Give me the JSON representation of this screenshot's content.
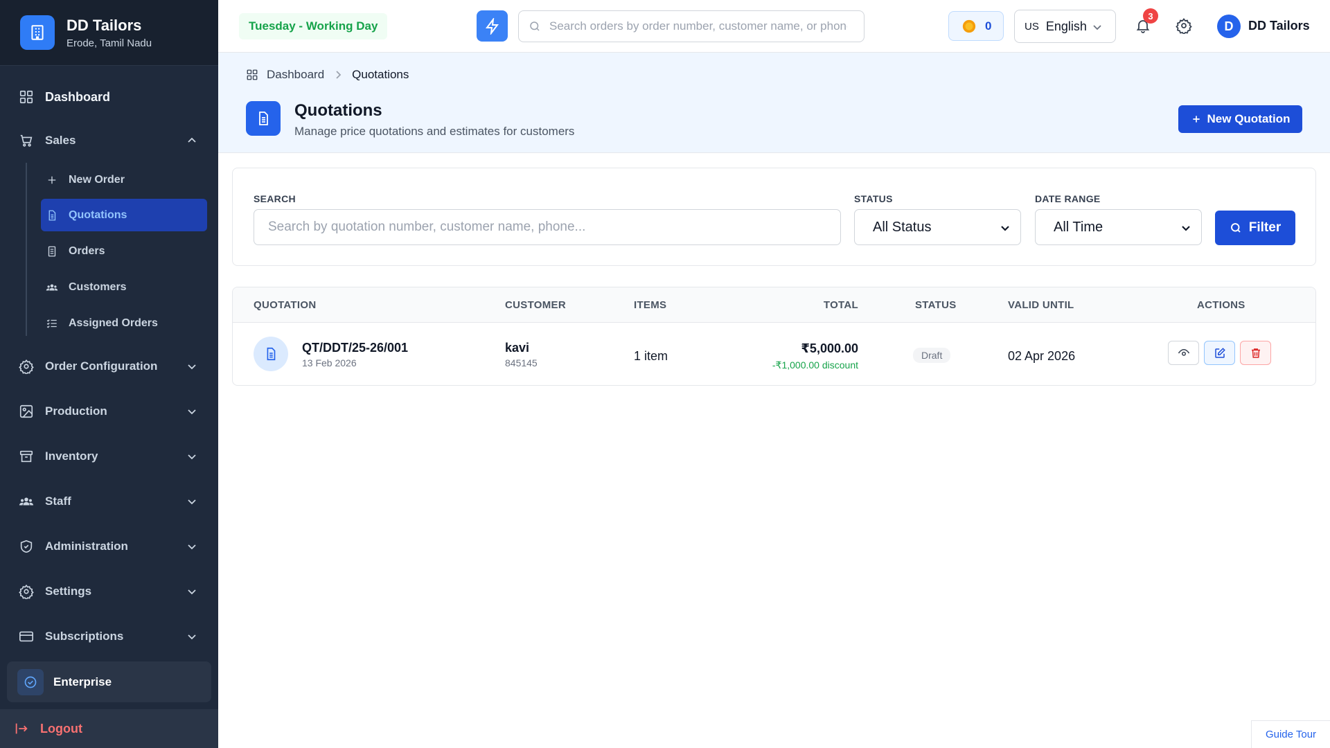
{
  "brand": {
    "name": "DD Tailors",
    "location": "Erode, Tamil Nadu"
  },
  "sidebar": {
    "dashboard": "Dashboard",
    "sales": "Sales",
    "sales_items": [
      "New Order",
      "Quotations",
      "Orders",
      "Customers",
      "Assigned Orders"
    ],
    "active_item": "Quotations",
    "sections": [
      "Order Configuration",
      "Production",
      "Inventory",
      "Staff",
      "Administration",
      "Settings",
      "Subscriptions"
    ],
    "plan": "Enterprise",
    "logout": "Logout"
  },
  "header": {
    "day_status": "Tuesday - Working Day",
    "search_placeholder": "Search orders by order number, customer name, or phone...",
    "coins": "0",
    "lang_flag": "US",
    "language": "English",
    "notifications": "3",
    "avatar_initial": "D",
    "user_name": "DD Tailors"
  },
  "breadcrumb": {
    "home": "Dashboard",
    "current": "Quotations"
  },
  "page": {
    "title": "Quotations",
    "subtitle": "Manage price quotations and estimates for customers",
    "new_button": "New Quotation"
  },
  "filters": {
    "search_label": "SEARCH",
    "search_placeholder": "Search by quotation number, customer name, phone...",
    "status_label": "STATUS",
    "status_value": "All Status",
    "date_label": "DATE RANGE",
    "date_value": "All Time",
    "filter_button": "Filter"
  },
  "table": {
    "columns": [
      "QUOTATION",
      "CUSTOMER",
      "ITEMS",
      "TOTAL",
      "STATUS",
      "VALID UNTIL",
      "ACTIONS"
    ],
    "rows": [
      {
        "number": "QT/DDT/25-26/001",
        "date": "13 Feb 2026",
        "customer": "kavi",
        "phone": "845145",
        "items": "1 item",
        "total": "₹5,000.00",
        "discount": "-₹1,000.00 discount",
        "status": "Draft",
        "valid_until": "02 Apr 2026"
      }
    ]
  },
  "guide_tour": "Guide Tour",
  "colors": {
    "sidebar_bg": "#1f2a3c",
    "accent": "#1d4ed8",
    "active_nav": "#1e40af",
    "danger": "#ef4444",
    "success": "#16a34a"
  }
}
